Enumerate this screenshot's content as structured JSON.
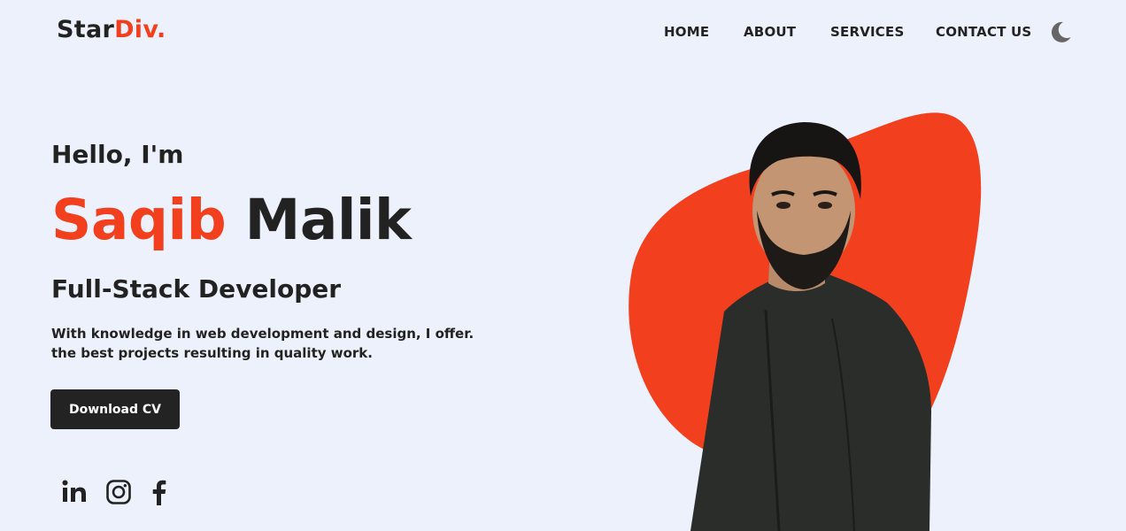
{
  "header": {
    "logo_main": "Star",
    "logo_accent": "Div."
  },
  "nav": {
    "items": [
      {
        "label": "HOME"
      },
      {
        "label": "ABOUT"
      },
      {
        "label": "SERVICES"
      },
      {
        "label": "CONTACT US"
      }
    ],
    "theme_toggle_icon": "moon-icon"
  },
  "hero": {
    "greeting": "Hello, I'm",
    "first_name": "Saqib",
    "last_name": "Malik",
    "role": "Full-Stack Developer",
    "description_line1": "With knowledge in web development and design, I offer.",
    "description_line2": "the best projects resulting in quality work.",
    "cta_label": "Download CV"
  },
  "social": [
    {
      "icon": "linkedin-icon"
    },
    {
      "icon": "instagram-icon"
    },
    {
      "icon": "facebook-icon"
    }
  ],
  "colors": {
    "accent": "#f2401f",
    "background": "#edf1fb",
    "text": "#222222",
    "button": "#232323"
  }
}
